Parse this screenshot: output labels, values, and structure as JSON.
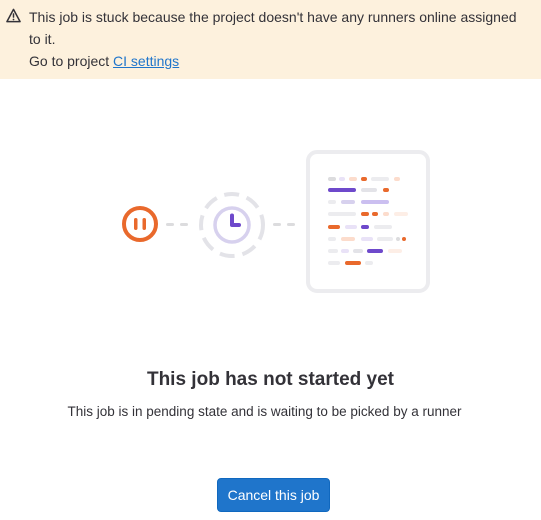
{
  "alert": {
    "message": "This job is stuck because the project doesn't have any runners online assigned to it.",
    "goto_prefix": "Go to project ",
    "link_label": "CI settings",
    "icon": "warning-icon"
  },
  "empty_state": {
    "title": "This job has not started yet",
    "description": "This job is in pending state and is waiting to be picked by a runner",
    "illustration": "pending-job-illustration"
  },
  "actions": {
    "cancel_label": "Cancel this job"
  },
  "colors": {
    "alert_bg": "#fdf1dd",
    "link": "#1f75cb",
    "primary_button": "#1f75cb",
    "orange": "#e9692c",
    "purple": "#6e49cb"
  }
}
